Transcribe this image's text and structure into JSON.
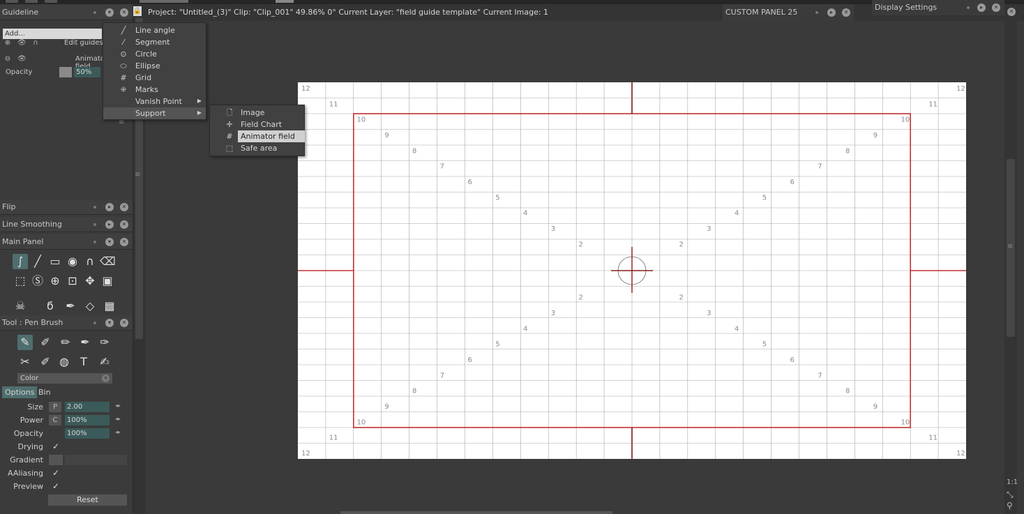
{
  "guideline_panel": {
    "title": "Guideline",
    "add_label": "Add...",
    "rows": [
      {
        "label": "Edit guides"
      },
      {
        "label": "Animator field"
      }
    ],
    "opacity_label": "Opacity",
    "opacity_value": "50%"
  },
  "collapsed_panels": {
    "flip": "Flip",
    "line_smoothing": "Line Smoothing",
    "main_panel": "Main Panel"
  },
  "tool_panel": {
    "title": "Tool : Pen Brush",
    "color_label": "Color",
    "tabs": [
      "Options",
      "Bin"
    ],
    "size_label": "Size",
    "size_mod": "P",
    "size_value": "2.00",
    "power_label": "Power",
    "power_mod": "C",
    "power_value": "100%",
    "opacity_label": "Opacity",
    "opacity_value": "100%",
    "drying_label": "Drying",
    "gradient_label": "Gradient",
    "aaliasing_label": "AAliasing",
    "preview_label": "Preview",
    "reset_label": "Reset",
    "check_glyph": "✓"
  },
  "infobar": {
    "text": "Project:  \"Untitled_(3)\"  Clip: \"Clip_001\"   49.86%   0°   Current Layer: \"field guide template\"  Current Image: 1"
  },
  "custom_panel": {
    "title": "CUSTOM PANEL 25"
  },
  "display_settings": {
    "title": "Display Settings"
  },
  "guide_menu": {
    "items": [
      {
        "label": "Line angle",
        "icon": "line-angle-icon"
      },
      {
        "label": "Segment",
        "icon": "segment-icon"
      },
      {
        "label": "Circle",
        "icon": "circle-icon"
      },
      {
        "label": "Ellipse",
        "icon": "ellipse-icon"
      },
      {
        "label": "Grid",
        "icon": "grid-icon"
      },
      {
        "label": "Marks",
        "icon": "marks-icon"
      },
      {
        "label": "Vanish Point",
        "icon": ""
      },
      {
        "label": "Support",
        "icon": ""
      }
    ]
  },
  "support_menu": {
    "items": [
      {
        "label": "Image",
        "icon": "image-icon"
      },
      {
        "label": "Field Chart",
        "icon": "field-chart-icon"
      },
      {
        "label": "Animator field",
        "icon": "animator-field-icon"
      },
      {
        "label": "Safe area",
        "icon": "safe-area-icon"
      }
    ]
  },
  "field_guide": {
    "ring_numbers": [
      "12",
      "11",
      "10",
      "9",
      "8",
      "7",
      "6",
      "5",
      "4",
      "3",
      "2"
    ],
    "lower_numbers": [
      "2",
      "3",
      "4",
      "5",
      "6",
      "7",
      "8",
      "9",
      "10",
      "11",
      "12"
    ],
    "red_color": "#c03030"
  },
  "zoom": {
    "one_to_one": "1:1"
  }
}
